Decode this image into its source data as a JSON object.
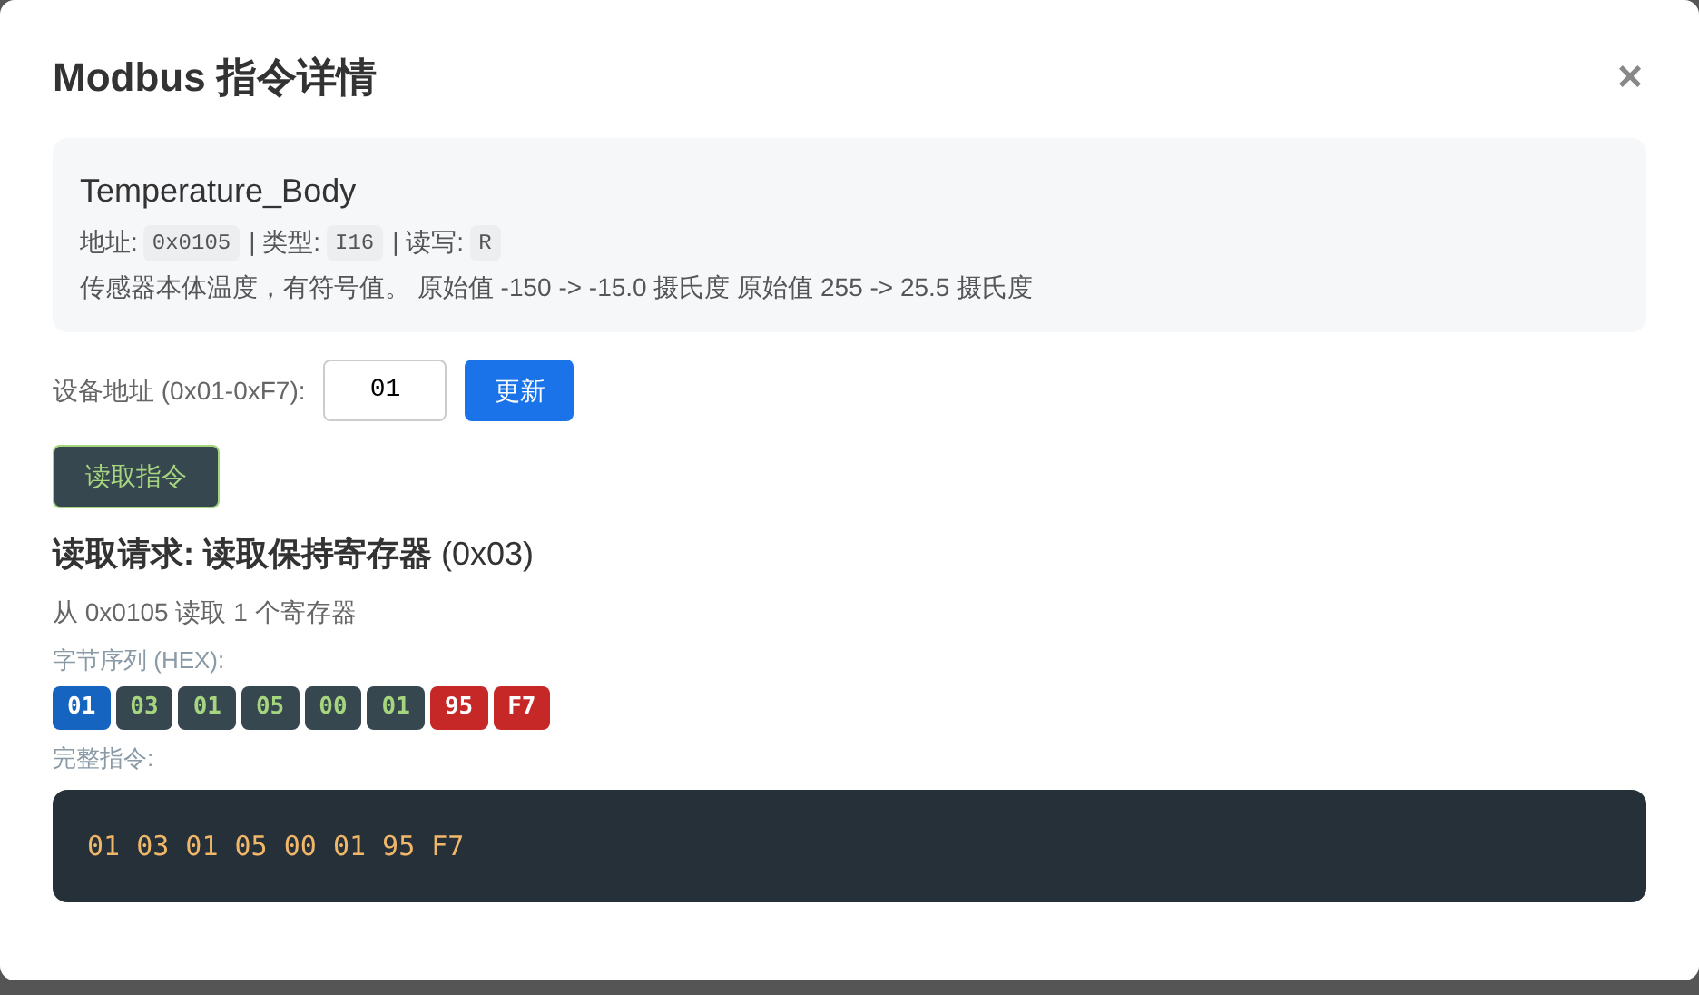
{
  "dialog": {
    "title": "Modbus 指令详情",
    "close": "×"
  },
  "point": {
    "name": "Temperature_Body",
    "meta": [
      {
        "label": "地址:",
        "value": "0x0105"
      },
      {
        "label": "| 类型:",
        "value": "I16"
      },
      {
        "label": "| 读写:",
        "value": "R"
      }
    ],
    "description": "传感器本体温度，有符号值。 原始值 -150 -> -15.0 摄氏度 原始值 255 -> 25.5 摄氏度"
  },
  "device_address": {
    "label": "设备地址 (0x01-0xF7):",
    "value": "01",
    "button": "更新"
  },
  "read_button": "读取指令",
  "request": {
    "title": "读取请求: 读取保持寄存器",
    "code": "(0x03)",
    "summary": "从 0x0105 读取 1 个寄存器"
  },
  "bytes_label": "字节序列 (HEX):",
  "bytes": [
    {
      "text": "01",
      "kind": "address"
    },
    {
      "text": "03",
      "kind": "data"
    },
    {
      "text": "01",
      "kind": "data"
    },
    {
      "text": "05",
      "kind": "data"
    },
    {
      "text": "00",
      "kind": "data"
    },
    {
      "text": "01",
      "kind": "data"
    },
    {
      "text": "95",
      "kind": "crc"
    },
    {
      "text": "F7",
      "kind": "crc"
    }
  ],
  "full_label": "完整指令:",
  "full_command": "01 03 01 05 00 01 95 F7"
}
